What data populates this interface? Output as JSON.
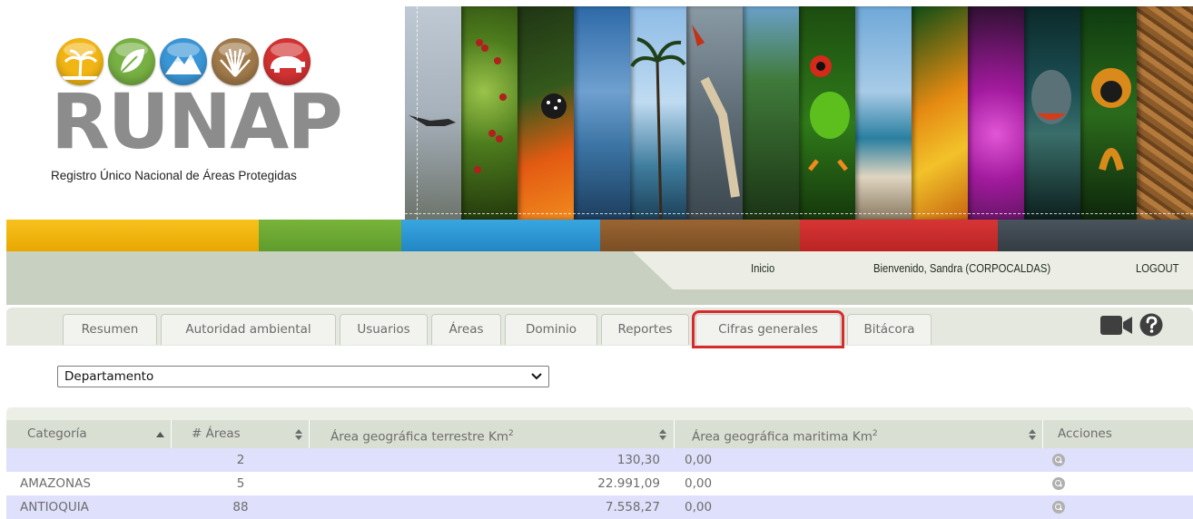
{
  "header": {
    "logo_text": "RUNAP",
    "logo_subtitle": "Registro Único Nacional de Áreas Protegidas"
  },
  "colors": {
    "bar": [
      "#f5b700",
      "#6fab33",
      "#2e9bd6",
      "#8b5a2b",
      "#cf2e2e",
      "#3d4750"
    ],
    "highlight": "#d82a2d",
    "row_alt": "#dfe0fb"
  },
  "topnav": {
    "inicio": "Inicio",
    "welcome": "Bienvenido, Sandra (CORPOCALDAS)",
    "logout": "LOGOUT"
  },
  "tabs": [
    {
      "label": "Resumen"
    },
    {
      "label": "Autoridad ambiental"
    },
    {
      "label": "Usuarios"
    },
    {
      "label": "Áreas"
    },
    {
      "label": "Dominio"
    },
    {
      "label": "Reportes"
    },
    {
      "label": "Cifras generales",
      "active": true
    },
    {
      "label": "Bitácora"
    }
  ],
  "icons": {
    "video": "video-camera-icon",
    "help": "help-circle-icon"
  },
  "filter": {
    "selected": "Departamento"
  },
  "table": {
    "headers": {
      "categoria": "Categoría",
      "areas": "# Áreas",
      "terrestre": "Área geográfica terrestre Km",
      "maritima": "Área geográfica maritima Km",
      "acciones": "Acciones",
      "superscript": "2"
    },
    "rows": [
      {
        "categoria": "",
        "areas": "2",
        "terrestre": "130,30",
        "maritima": "0,00"
      },
      {
        "categoria": "AMAZONAS",
        "areas": "5",
        "terrestre": "22.991,09",
        "maritima": "0,00"
      },
      {
        "categoria": "ANTIOQUIA",
        "areas": "88",
        "terrestre": "7.558,27",
        "maritima": "0,00"
      }
    ]
  }
}
